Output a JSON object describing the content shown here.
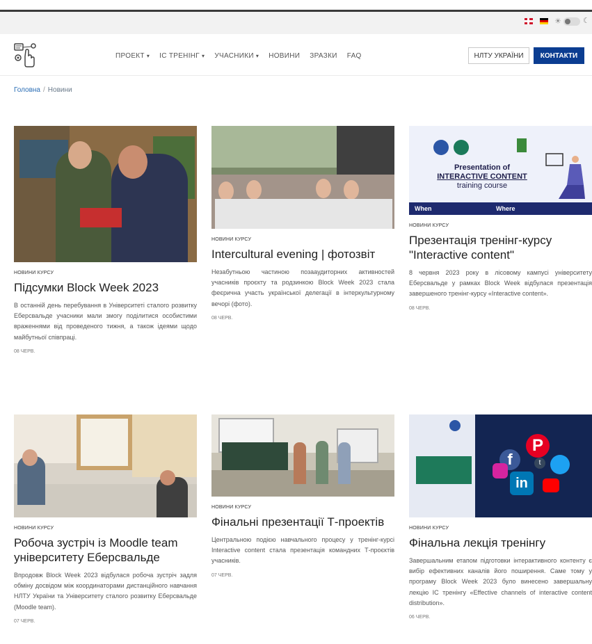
{
  "topbar": {
    "flags": [
      "uk-flag",
      "de-flag"
    ],
    "theme_icons": [
      "sun-icon",
      "moon-icon"
    ]
  },
  "nav": {
    "items": [
      {
        "label": "ПРОЕКТ",
        "dropdown": true
      },
      {
        "label": "IC ТРЕНІНГ",
        "dropdown": true
      },
      {
        "label": "УЧАСНИКИ",
        "dropdown": true
      },
      {
        "label": "НОВИНИ",
        "dropdown": false
      },
      {
        "label": "ЗРАЗКИ",
        "dropdown": false
      },
      {
        "label": "FAQ",
        "dropdown": false
      }
    ],
    "btn_nltu": "НЛТУ УКРАЇНИ",
    "btn_contacts": "КОНТАКТИ"
  },
  "breadcrumb": {
    "home": "Головна",
    "current": "Новини"
  },
  "cards": [
    {
      "category": "НОВИНИ КУРСУ",
      "title": "Підсумки Block Week 2023",
      "description": "В останній день перебування в Університеті сталого розвитку Еберсвальде учасники мали змогу поділитися особистими враженнями від проведеного тижня, а також ідеями щодо майбутньої співпраці.",
      "date": "08 ЧЕРВ."
    },
    {
      "category": "НОВИНИ КУРСУ",
      "title": "Intercultural evening | фотозвіт",
      "description": "Незабутньою частиною позааудиторних активностей учасників проєкту та родзинкою Block Week 2023 стала феєрична участь української делегації в інтеркультурному вечорі (фото).",
      "date": "08 ЧЕРВ."
    },
    {
      "category": "НОВИНИ КУРСУ",
      "title": "Презентація тренінг-курсу \"Interactive content\"",
      "description": "8 червня 2023 року в лісовому кампусі університету Еберсвальде у рамках Block Week відбулася презентація завершеного тренінг-курсу «Interactive content».",
      "date": "08 ЧЕРВ.",
      "image_text": {
        "line1": "Presentation of",
        "line2": "INTERACTIVE CONTENT",
        "line3": "training course",
        "when": "When",
        "where": "Where"
      }
    },
    {
      "category": "НОВИНИ КУРСУ",
      "title": "Робоча зустріч із Moodle team університету Еберсвальде",
      "description": "Впродовж Block Week 2023 відбулася робоча зустріч задля обміну досвідом між координаторами дистанційного навчання НЛТУ України та Університету сталого розвитку Еберсвальде (Moodle team).",
      "date": "07 ЧЕРВ."
    },
    {
      "category": "НОВИНИ КУРСУ",
      "title": "Фінальні презентації Т-проектів",
      "description": "Центральною подією навчального процесу у тренінг-курсі Interactive content стала презентація командних Т-проєктів учасників.",
      "date": "07 ЧЕРВ."
    },
    {
      "category": "НОВИНИ КУРСУ",
      "title": "Фінальна лекція тренінгу",
      "description": "Завершальним етапом підготовки інтерактивного контенту є вибір ефективних каналів його поширення. Саме тому у програму Block Week 2023 було винесено завершальну лекцію IC тренінгу «Effective channels of interactive content distribution».",
      "date": "06 ЧЕРВ."
    }
  ],
  "colors": {
    "primary": "#0b3d91",
    "topbar_bg": "#f2f2f2"
  }
}
